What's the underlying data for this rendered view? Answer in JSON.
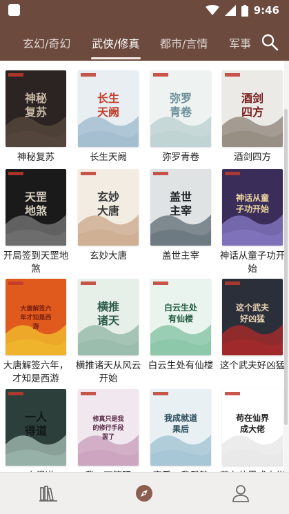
{
  "status_bar": {
    "time": "9:46"
  },
  "tabs": [
    {
      "label": "玄幻/奇幻",
      "active": false
    },
    {
      "label": "武侠/修真",
      "active": true
    },
    {
      "label": "都市/言情",
      "active": false
    },
    {
      "label": "军事",
      "active": false
    }
  ],
  "colors": {
    "appbar": "#6d4a3e",
    "nav_active": "#8b5e4f",
    "nav_inactive": "#6b6b6b"
  },
  "books": [
    {
      "title": "神秘复苏",
      "cover_text": "神秘复苏"
    },
    {
      "title": "长生天阙",
      "cover_text": "长生天阙"
    },
    {
      "title": "弥罗青卷",
      "cover_text": "弥罗青卷"
    },
    {
      "title": "酒剑四方",
      "cover_text": "酒剑四方"
    },
    {
      "title": "开局签到天罡地煞",
      "cover_text": "天罡地煞"
    },
    {
      "title": "玄妙大唐",
      "cover_text": "玄妙大唐"
    },
    {
      "title": "盖世主宰",
      "cover_text": "盖世主宰"
    },
    {
      "title": "神话从童子功开始",
      "cover_text": "神话从童子功开始"
    },
    {
      "title": "大唐解签六年，才知是西游",
      "cover_text": "大唐解签六年才知是西游"
    },
    {
      "title": "横推诸天从风云开始",
      "cover_text": "横推诸天"
    },
    {
      "title": "白云生处有仙楼",
      "cover_text": "白云生处有仙楼"
    },
    {
      "title": "这个武夫好凶猛",
      "cover_text": "这个武夫好凶猛"
    },
    {
      "title": "一人得道",
      "cover_text": "一人得道"
    },
    {
      "title": "我，万篇强",
      "cover_text": "修真只是我的修行手段罢了"
    },
    {
      "title": "官爱，我武静",
      "cover_text": "我成就道果后"
    },
    {
      "title": "苟在仙界成大佬",
      "cover_text": "苟在仙界成大佬"
    }
  ],
  "bottom_nav": [
    {
      "name": "bookshelf",
      "icon": "bookshelf-icon"
    },
    {
      "name": "discover",
      "icon": "compass-icon",
      "active": true
    },
    {
      "name": "profile",
      "icon": "person-icon"
    }
  ]
}
